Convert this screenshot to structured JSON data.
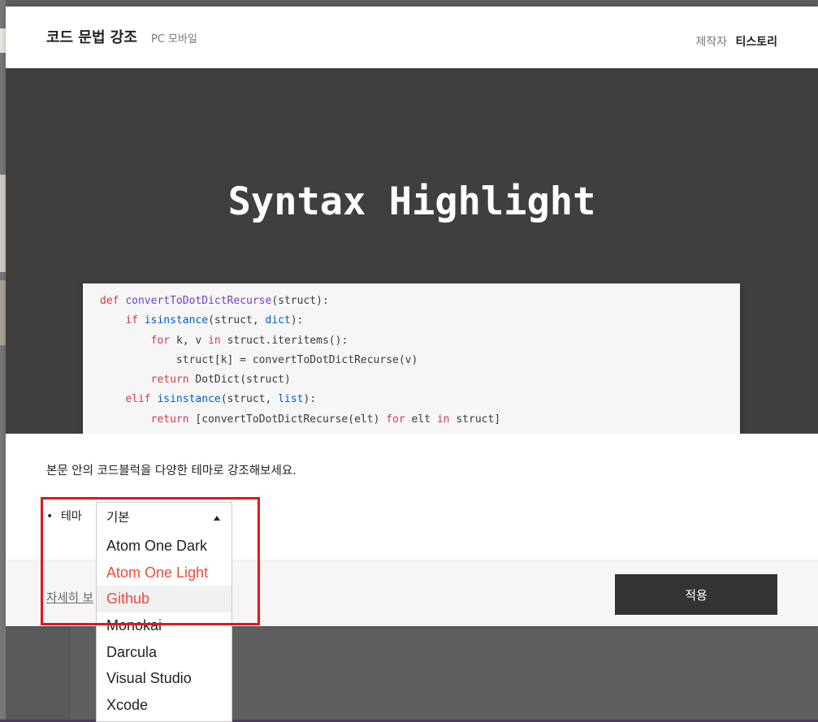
{
  "modal": {
    "title": "코드 문법 강조",
    "subtitle": "PC 모바일",
    "maker_label": "제작자",
    "maker_name": "티스토리"
  },
  "preview": {
    "title": "Syntax Highlight"
  },
  "code_lines": [
    [
      {
        "t": "def ",
        "c": "kw"
      },
      {
        "t": "convertToDotDictRecurse",
        "c": "fn"
      },
      {
        "t": "(struct):",
        "c": ""
      }
    ],
    [
      {
        "t": "    ",
        "c": ""
      },
      {
        "t": "if ",
        "c": "kw"
      },
      {
        "t": "isinstance",
        "c": "bi"
      },
      {
        "t": "(struct, ",
        "c": ""
      },
      {
        "t": "dict",
        "c": "bi"
      },
      {
        "t": "):",
        "c": ""
      }
    ],
    [
      {
        "t": "        ",
        "c": ""
      },
      {
        "t": "for ",
        "c": "kw"
      },
      {
        "t": "k, v ",
        "c": ""
      },
      {
        "t": "in ",
        "c": "kw"
      },
      {
        "t": "struct.iteritems():",
        "c": ""
      }
    ],
    [
      {
        "t": "            struct[k] = convertToDotDictRecurse(v)",
        "c": ""
      }
    ],
    [
      {
        "t": "        ",
        "c": ""
      },
      {
        "t": "return ",
        "c": "kw"
      },
      {
        "t": "DotDict(struct)",
        "c": ""
      }
    ],
    [
      {
        "t": "    ",
        "c": ""
      },
      {
        "t": "elif ",
        "c": "kw"
      },
      {
        "t": "isinstance",
        "c": "bi"
      },
      {
        "t": "(struct, ",
        "c": ""
      },
      {
        "t": "list",
        "c": "bi"
      },
      {
        "t": "):",
        "c": ""
      }
    ],
    [
      {
        "t": "        ",
        "c": ""
      },
      {
        "t": "return ",
        "c": "kw"
      },
      {
        "t": "[convertToDotDictRecurse(elt) ",
        "c": ""
      },
      {
        "t": "for ",
        "c": "kw"
      },
      {
        "t": "elt ",
        "c": ""
      },
      {
        "t": "in ",
        "c": "kw"
      },
      {
        "t": "struct]",
        "c": ""
      }
    ]
  ],
  "description": "본문 안의 코드블럭을 다양한 테마로 강조해보세요.",
  "theme_option": {
    "bullet": "•",
    "label": "테마",
    "selected": "기본",
    "options": [
      "Atom One Dark",
      "Atom One Light",
      "Github",
      "Monokai",
      "Darcula",
      "Visual Studio",
      "Xcode"
    ]
  },
  "footer": {
    "more_link": "자세히 보",
    "apply_label": "적용"
  },
  "colors": {
    "highlight_red": "#ef4a3a",
    "annotation_red": "#e4161e",
    "preview_bg": "#3f3f3f",
    "button_bg": "#333333"
  }
}
